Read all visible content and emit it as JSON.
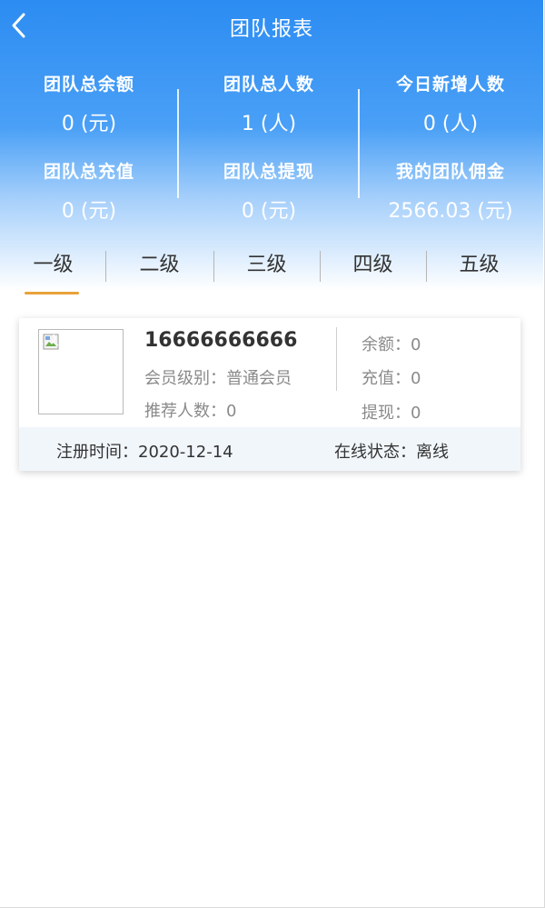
{
  "header": {
    "title": "团队报表"
  },
  "stats": [
    {
      "label": "团队总余额",
      "value": "0 (元)"
    },
    {
      "label": "团队总人数",
      "value": "1 (人)"
    },
    {
      "label": "今日新增人数",
      "value": "0 (人)"
    },
    {
      "label": "团队总充值",
      "value": "0 (元)"
    },
    {
      "label": "团队总提现",
      "value": "0 (元)"
    },
    {
      "label": "我的团队佣金",
      "value": "2566.03 (元)"
    }
  ],
  "tabs": [
    {
      "label": "一级",
      "active": true
    },
    {
      "label": "二级",
      "active": false
    },
    {
      "label": "三级",
      "active": false
    },
    {
      "label": "四级",
      "active": false
    },
    {
      "label": "五级",
      "active": false
    }
  ],
  "member": {
    "phone": "16666666666",
    "level_text": "会员级别：普通会员",
    "referrals_text": "推荐人数：0",
    "balance_text": "余额：0",
    "recharge_text": "充值：0",
    "withdraw_text": "提现：0",
    "register_text": "注册时间：2020-12-14",
    "online_text": "在线状态：离线"
  },
  "colors": {
    "header_blue": "#2c8cf2",
    "tab_accent": "#e8a23a"
  },
  "icons": {
    "back": "chevron-left-icon",
    "avatar_placeholder": "broken-image-icon"
  }
}
